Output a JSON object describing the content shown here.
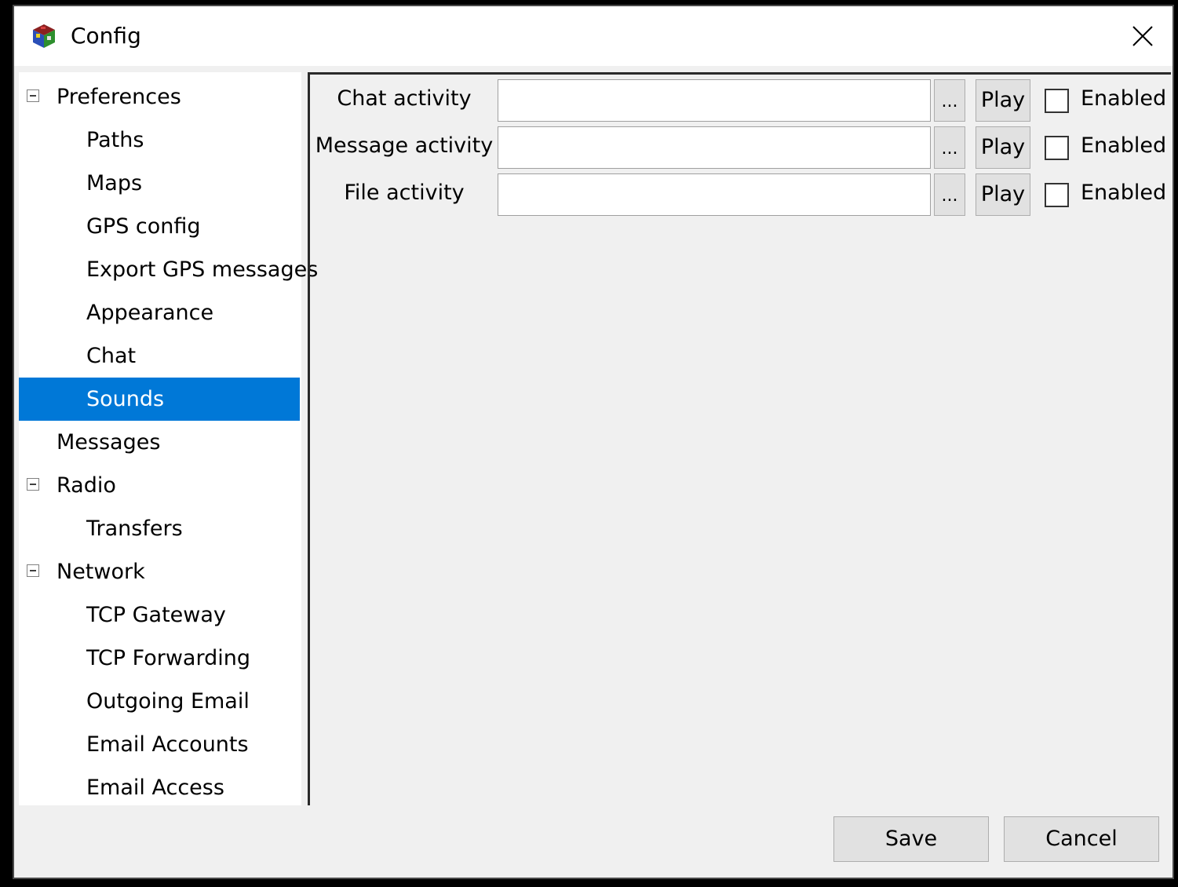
{
  "window": {
    "title": "Config",
    "app_icon": "cube-app-icon",
    "close_icon": "close-icon"
  },
  "tree": {
    "items": [
      {
        "label": "Preferences",
        "level": 0,
        "expanded": true
      },
      {
        "label": "Paths",
        "level": 1
      },
      {
        "label": "Maps",
        "level": 1
      },
      {
        "label": "GPS config",
        "level": 1
      },
      {
        "label": "Export GPS messages",
        "level": 1
      },
      {
        "label": "Appearance",
        "level": 1
      },
      {
        "label": "Chat",
        "level": 1
      },
      {
        "label": "Sounds",
        "level": 1,
        "selected": true
      },
      {
        "label": "Messages",
        "level": 0
      },
      {
        "label": "Radio",
        "level": 0,
        "expanded": true
      },
      {
        "label": "Transfers",
        "level": 1
      },
      {
        "label": "Network",
        "level": 0,
        "expanded": true
      },
      {
        "label": "TCP Gateway",
        "level": 1
      },
      {
        "label": "TCP Forwarding",
        "level": 1
      },
      {
        "label": "Outgoing Email",
        "level": 1
      },
      {
        "label": "Email Accounts",
        "level": 1
      },
      {
        "label": "Email Access",
        "level": 1
      }
    ]
  },
  "sounds": {
    "rows": [
      {
        "label": "Chat activity",
        "value": "",
        "browse_label": "...",
        "play_label": "Play",
        "enabled_label": "Enabled",
        "enabled": false
      },
      {
        "label": "Message activity",
        "value": "",
        "browse_label": "...",
        "play_label": "Play",
        "enabled_label": "Enabled",
        "enabled": false
      },
      {
        "label": "File activity",
        "value": "",
        "browse_label": "...",
        "play_label": "Play",
        "enabled_label": "Enabled",
        "enabled": false
      }
    ]
  },
  "buttons": {
    "save_label": "Save",
    "cancel_label": "Cancel"
  },
  "colors": {
    "selection": "#0078d7",
    "window_bg": "#f0f0f0"
  }
}
